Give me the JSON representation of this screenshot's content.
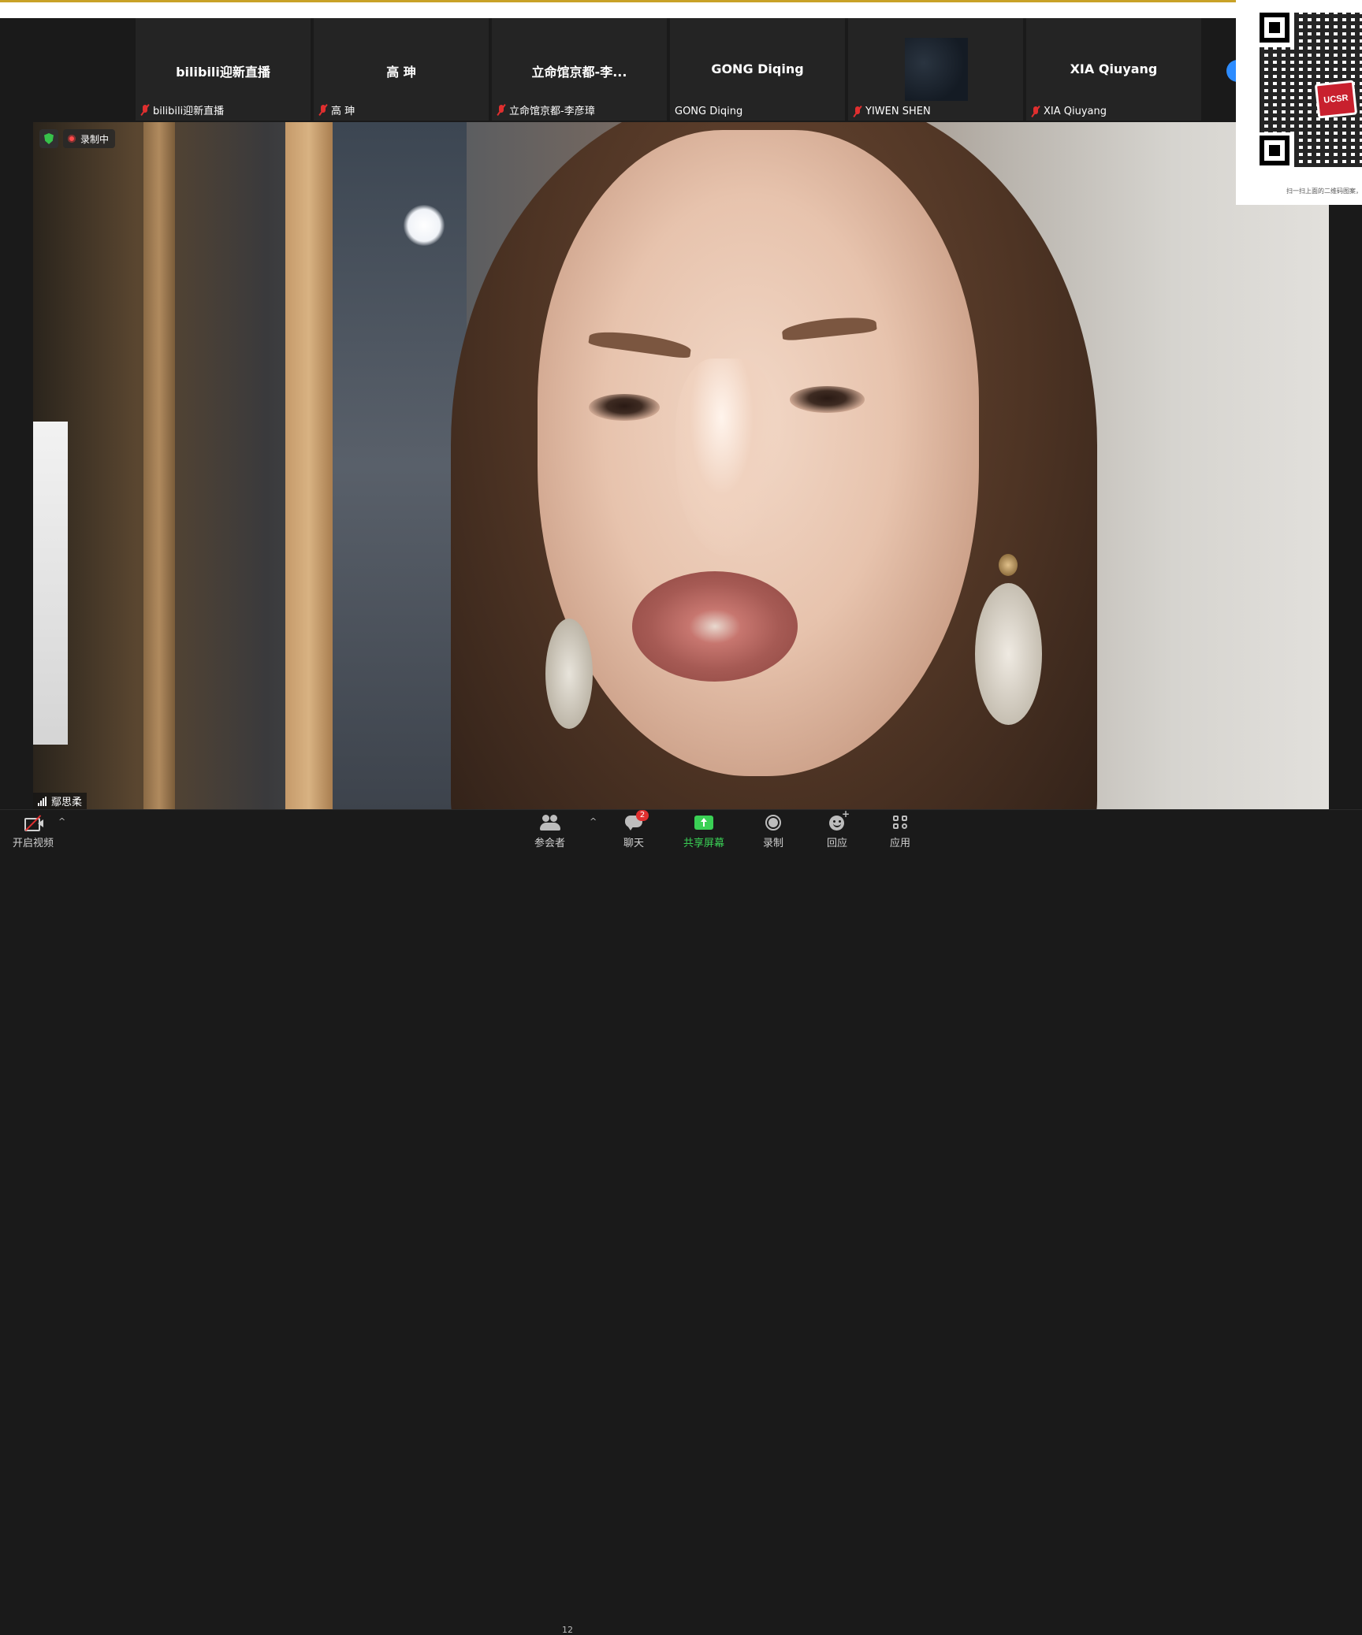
{
  "participants_strip": [
    {
      "display_name": "bilibili迎新直播",
      "label": "bilibili迎新直播",
      "muted": true
    },
    {
      "display_name": "高 珅",
      "label": "高 珅",
      "muted": true
    },
    {
      "display_name": "立命馆京都-李...",
      "label": "立命馆京都-李彦璋",
      "muted": true
    },
    {
      "display_name": "GONG Diqing",
      "label": "GONG Diqing",
      "muted": false
    },
    {
      "display_name": "",
      "label": "YIWEN SHEN",
      "muted": true,
      "has_video": true
    },
    {
      "display_name": "XIA Qiuyang",
      "label": "XIA Qiuyang",
      "muted": true
    }
  ],
  "main_video": {
    "recording_label": "录制中",
    "speaker_name": "鄢思柔"
  },
  "qr_panel": {
    "logo_text": "UCSR",
    "caption": "扫一扫上面的二维码图案，..."
  },
  "toolbar": {
    "start_video_label": "开启视频",
    "participants_label": "参会者",
    "participants_count": "12",
    "chat_label": "聊天",
    "chat_badge": "2",
    "share_screen_label": "共享屏幕",
    "record_label": "录制",
    "reactions_label": "回应",
    "apps_label": "应用"
  },
  "colors": {
    "accent_green": "#3ad055",
    "alert_red": "#e02f2f",
    "highlight_blue": "#2d8cff",
    "top_accent": "#c9a227"
  }
}
